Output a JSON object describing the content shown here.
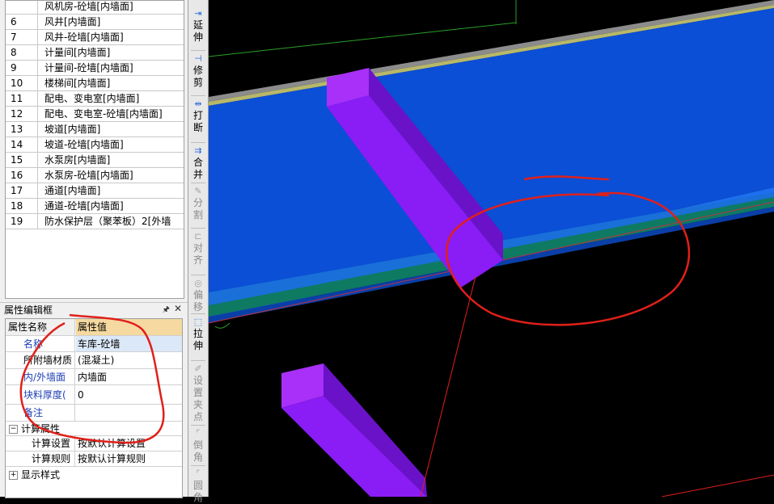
{
  "wall_list": [
    {
      "num": "",
      "name": "风机房-砼墙[内墙面]"
    },
    {
      "num": "6",
      "name": "风井[内墙面]"
    },
    {
      "num": "7",
      "name": "风井-砼墙[内墙面]"
    },
    {
      "num": "8",
      "name": "计量间[内墙面]"
    },
    {
      "num": "9",
      "name": "计量间-砼墙[内墙面]"
    },
    {
      "num": "10",
      "name": "楼梯间[内墙面]"
    },
    {
      "num": "11",
      "name": "配电、变电室[内墙面]"
    },
    {
      "num": "12",
      "name": "配电、变电室-砼墙[内墙面]"
    },
    {
      "num": "13",
      "name": "坡道[内墙面]"
    },
    {
      "num": "14",
      "name": "坡道-砼墙[内墙面]"
    },
    {
      "num": "15",
      "name": "水泵房[内墙面]"
    },
    {
      "num": "16",
      "name": "水泵房-砼墙[内墙面]"
    },
    {
      "num": "17",
      "name": "通道[内墙面]"
    },
    {
      "num": "18",
      "name": "通道-砼墙[内墙面]"
    },
    {
      "num": "19",
      "name": "防水保护层（聚苯板）2[外墙"
    }
  ],
  "property_panel": {
    "title": "属性编辑框",
    "pin_icon": "pin-icon",
    "close_icon": "close-icon",
    "col_name": "属性名称",
    "col_value": "属性值",
    "rows": [
      {
        "key": "名称",
        "value": "车库-砼墙"
      },
      {
        "key": "所附墙材质",
        "value": "(混凝土)"
      },
      {
        "key": "内/外墙面",
        "value": "内墙面"
      },
      {
        "key": "块料厚度(",
        "value": "0"
      },
      {
        "key": "备注",
        "value": ""
      }
    ],
    "group_calc": "计算属性",
    "group_calc_toggle": "−",
    "calc_rows": [
      {
        "key": "计算设置",
        "value": "按默认计算设置"
      },
      {
        "key": "计算规则",
        "value": "按默认计算规则"
      }
    ],
    "group_style": "显示样式",
    "group_style_toggle": "+"
  },
  "toolbar": [
    {
      "label": "延伸",
      "icon": "extend-icon",
      "glyph": "⇥",
      "enabled": true
    },
    {
      "label": "修剪",
      "icon": "trim-icon",
      "glyph": "⊣",
      "enabled": true
    },
    {
      "label": "打断",
      "icon": "break-icon",
      "glyph": "⇹",
      "enabled": true
    },
    {
      "label": "合并",
      "icon": "merge-icon",
      "glyph": "⇉",
      "enabled": true
    },
    {
      "label": "分割",
      "icon": "split-icon",
      "glyph": "✎",
      "enabled": false
    },
    {
      "label": "对齐",
      "icon": "align-icon",
      "glyph": "⊏",
      "enabled": false
    },
    {
      "label": "偏移",
      "icon": "offset-icon",
      "glyph": "◎",
      "enabled": false
    },
    {
      "label": "拉伸",
      "icon": "stretch-icon",
      "glyph": "⬚",
      "enabled": true
    },
    {
      "label": "设置夹点",
      "icon": "grip-icon",
      "glyph": "✐",
      "enabled": false
    },
    {
      "label": "倒角",
      "icon": "chamfer-icon",
      "glyph": "⌜",
      "enabled": false
    },
    {
      "label": "圆角",
      "icon": "fillet-icon",
      "glyph": "⌜",
      "enabled": false
    }
  ],
  "colors": {
    "slab": "#0a4fd6",
    "column": "#8a1cf5",
    "annotation": "#e0201a"
  }
}
